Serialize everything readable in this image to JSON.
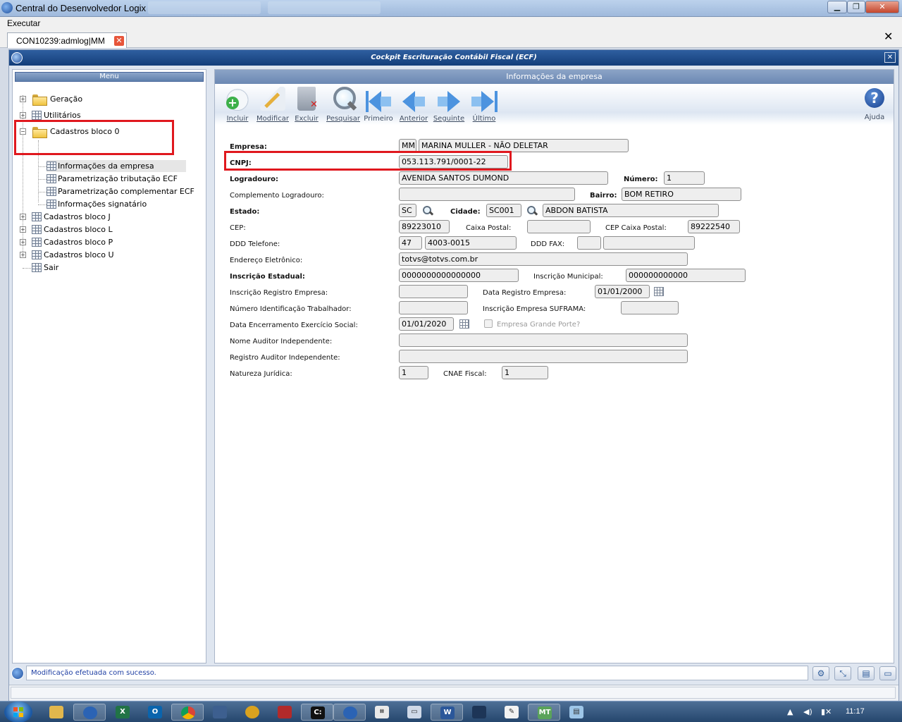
{
  "window": {
    "title": "Central do Desenvolvedor Logix",
    "minimize": "▁",
    "maximize": "❐",
    "close": "✕"
  },
  "menubar": {
    "executar": "Executar"
  },
  "tabs": [
    {
      "label": "CON10239:admlog|MM",
      "close": "✕"
    }
  ],
  "close_all": "✕",
  "inner_window": {
    "title": "Cockpit Escrituração Contábil Fiscal (ECF)",
    "close": "✕"
  },
  "menu": {
    "header": "Menu",
    "items": [
      {
        "label": "Geração",
        "icon": "folder-icon"
      },
      {
        "label": "Utilitários",
        "icon": "grid-icon"
      },
      {
        "label": "Cadastros bloco 0",
        "icon": "folder-open-icon"
      },
      {
        "label": "Informações da empresa",
        "icon": "grid-icon"
      },
      {
        "label": "Parametrização tributação ECF",
        "icon": "grid-icon"
      },
      {
        "label": "Parametrização complementar ECF",
        "icon": "grid-icon"
      },
      {
        "label": "Informações signatário",
        "icon": "grid-icon"
      },
      {
        "label": "Cadastros bloco J",
        "icon": "grid-icon"
      },
      {
        "label": "Cadastros bloco L",
        "icon": "grid-icon"
      },
      {
        "label": "Cadastros bloco P",
        "icon": "grid-icon"
      },
      {
        "label": "Cadastros bloco U",
        "icon": "grid-icon"
      },
      {
        "label": "Sair",
        "icon": "grid-icon"
      }
    ],
    "expander_plus": "+",
    "expander_minus": "−"
  },
  "form": {
    "header": "Informações da empresa",
    "toolbar": {
      "incluir": "Incluir",
      "modificar": "Modificar",
      "excluir": "Excluir",
      "pesquisar": "Pesquisar",
      "primeiro": "Primeiro",
      "anterior": "Anterior",
      "seguinte": "Seguinte",
      "ultimo": "Último",
      "ajuda": "Ajuda",
      "help_glyph": "?"
    },
    "labels": {
      "empresa": "Empresa:",
      "cnpj": "CNPJ:",
      "logradouro": "Logradouro:",
      "numero": "Número:",
      "complemento": "Complemento Logradouro:",
      "bairro": "Bairro:",
      "estado": "Estado:",
      "cidade": "Cidade:",
      "cep": "CEP:",
      "caixa_postal": "Caixa Postal:",
      "cep_caixa_postal": "CEP Caixa Postal:",
      "ddd_telefone": "DDD Telefone:",
      "ddd_fax": "DDD FAX:",
      "email": "Endereço Eletrônico:",
      "inscricao_estadual": "Inscrição Estadual:",
      "inscricao_municipal": "Inscrição Municipal:",
      "inscricao_registro": "Inscrição Registro Empresa:",
      "data_registro": "Data Registro Empresa:",
      "nit": "Número Identificação Trabalhador:",
      "suframa": "Inscrição Empresa SUFRAMA:",
      "data_encerramento": "Data Encerramento Exercício Social:",
      "grande_porte": "Empresa Grande Porte?",
      "nome_auditor": "Nome Auditor Independente:",
      "registro_auditor": "Registro Auditor Independente:",
      "natureza_juridica": "Natureza Jurídica:",
      "cnae": "CNAE Fiscal:"
    },
    "values": {
      "empresa_codigo": "MM",
      "empresa_nome": "MARINA MULLER - NÃO DELETAR",
      "cnpj": "053.113.791/0001-22",
      "logradouro": "AVENIDA SANTOS DUMOND",
      "numero": "1",
      "complemento": "",
      "bairro": "BOM RETIRO",
      "estado": "SC",
      "cidade_codigo": "SC001",
      "cidade_nome": "ABDON BATISTA",
      "cep": "89223010",
      "caixa_postal": "",
      "cep_caixa_postal": "89222540",
      "ddd": "47",
      "telefone": "4003-0015",
      "ddd_fax": "",
      "fax": "",
      "email": "totvs@totvs.com.br",
      "inscricao_estadual": "0000000000000000",
      "inscricao_municipal": "000000000000",
      "inscricao_registro": "",
      "data_registro": "01/01/2000",
      "nit": "",
      "suframa": "",
      "data_encerramento": "01/01/2020",
      "nome_auditor": "",
      "registro_auditor": "",
      "natureza_juridica": "1",
      "cnae": "1"
    }
  },
  "status": {
    "message": "Modificação efetuada com sucesso."
  },
  "taskbar": {
    "apps": [
      "file-explorer-icon",
      "logix-icon",
      "excel-icon",
      "outlook-icon",
      "chrome-icon",
      "network-icon",
      "ubuntu-icon",
      "media-icon",
      "cmd-icon",
      "logix2-icon",
      "calculator-icon",
      "window-icon",
      "word-icon",
      "app-icon",
      "paint-icon",
      "mt-icon",
      "notes-icon"
    ],
    "clock": "11:17"
  },
  "colors": {
    "highlight": "#e0181e",
    "accent": "#1f4e9c",
    "status_text": "#1f3fa3"
  }
}
